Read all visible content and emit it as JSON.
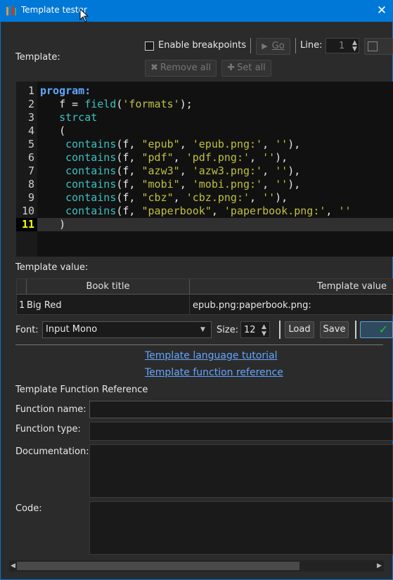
{
  "window": {
    "title": "Template tester",
    "close_glyph": "✕"
  },
  "toolbar": {
    "template_label": "Template:",
    "enable_breakpoints_label": "Enable breakpoints",
    "go_label": "Go",
    "line_label": "Line:",
    "line_value": "1",
    "remove_all_label": "Remove all",
    "set_all_label": "Set all"
  },
  "editor": {
    "line_numbers": [
      "1",
      "2",
      "3",
      "4",
      "5",
      "6",
      "7",
      "8",
      "9",
      "10",
      "11"
    ],
    "current_line": 11,
    "lines": [
      [
        {
          "t": "program:",
          "c": "kw"
        }
      ],
      [
        {
          "t": "   "
        },
        {
          "t": "f"
        },
        {
          "t": " = "
        },
        {
          "t": "field",
          "c": "fn"
        },
        {
          "t": "("
        },
        {
          "t": "'formats'",
          "c": "str"
        },
        {
          "t": ");"
        }
      ],
      [
        {
          "t": "   "
        },
        {
          "t": "strcat",
          "c": "fn"
        }
      ],
      [
        {
          "t": "   ("
        }
      ],
      [
        {
          "t": "    "
        },
        {
          "t": "contains",
          "c": "fn"
        },
        {
          "t": "(f, "
        },
        {
          "t": "\"epub\"",
          "c": "str"
        },
        {
          "t": ", "
        },
        {
          "t": "'epub.png:'",
          "c": "str"
        },
        {
          "t": ", "
        },
        {
          "t": "''",
          "c": "str"
        },
        {
          "t": "),"
        }
      ],
      [
        {
          "t": "    "
        },
        {
          "t": "contains",
          "c": "fn"
        },
        {
          "t": "(f, "
        },
        {
          "t": "\"pdf\"",
          "c": "str"
        },
        {
          "t": ", "
        },
        {
          "t": "'pdf.png:'",
          "c": "str"
        },
        {
          "t": ", "
        },
        {
          "t": "''",
          "c": "str"
        },
        {
          "t": "),"
        }
      ],
      [
        {
          "t": "    "
        },
        {
          "t": "contains",
          "c": "fn"
        },
        {
          "t": "(f, "
        },
        {
          "t": "\"azw3\"",
          "c": "str"
        },
        {
          "t": ", "
        },
        {
          "t": "'azw3.png:'",
          "c": "str"
        },
        {
          "t": ", "
        },
        {
          "t": "''",
          "c": "str"
        },
        {
          "t": "),"
        }
      ],
      [
        {
          "t": "    "
        },
        {
          "t": "contains",
          "c": "fn"
        },
        {
          "t": "(f, "
        },
        {
          "t": "\"mobi\"",
          "c": "str"
        },
        {
          "t": ", "
        },
        {
          "t": "'mobi.png:'",
          "c": "str"
        },
        {
          "t": ", "
        },
        {
          "t": "''",
          "c": "str"
        },
        {
          "t": "),"
        }
      ],
      [
        {
          "t": "    "
        },
        {
          "t": "contains",
          "c": "fn"
        },
        {
          "t": "(f, "
        },
        {
          "t": "\"cbz\"",
          "c": "str"
        },
        {
          "t": ", "
        },
        {
          "t": "'cbz.png:'",
          "c": "str"
        },
        {
          "t": ", "
        },
        {
          "t": "''",
          "c": "str"
        },
        {
          "t": "),"
        }
      ],
      [
        {
          "t": "    "
        },
        {
          "t": "contains",
          "c": "fn"
        },
        {
          "t": "(f, "
        },
        {
          "t": "\"paperbook\"",
          "c": "str"
        },
        {
          "t": ", "
        },
        {
          "t": "'paperbook.png:'",
          "c": "str"
        },
        {
          "t": ", "
        },
        {
          "t": "''",
          "c": "str"
        }
      ],
      [
        {
          "t": "   )"
        }
      ]
    ]
  },
  "template_value": {
    "label": "Template value:",
    "columns": [
      "Book title",
      "Template value"
    ],
    "rows": [
      {
        "index": "1",
        "book_title": "Big Red",
        "value": "epub.png:paperbook.png:"
      }
    ]
  },
  "font_bar": {
    "font_label": "Font:",
    "font_value": "Input Mono",
    "size_label": "Size:",
    "size_value": "12",
    "load_label": "Load",
    "save_label": "Save",
    "ok_glyph": "✓"
  },
  "links": {
    "tutorial": "Template language tutorial",
    "reference": "Template function reference"
  },
  "function_reference": {
    "heading": "Template Function Reference",
    "function_name_label": "Function name:",
    "function_type_label": "Function type:",
    "documentation_label": "Documentation:",
    "code_label": "Code:"
  },
  "colors": {
    "titlebar": "#0078d7",
    "keyword": "#5fa7ff",
    "function": "#3ec0c0",
    "string": "#c0c040",
    "link": "#61a6ff",
    "current_line_number": "#ffff00"
  }
}
